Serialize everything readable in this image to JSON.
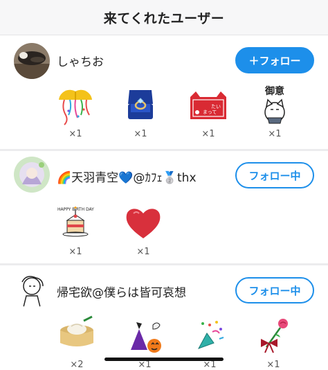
{
  "header": {
    "title": "来てくれたユーザー"
  },
  "users": [
    {
      "name": "しゃちお",
      "follow_label": "＋フォロー",
      "gifts": [
        {
          "icon": "ribbon-balls-icon",
          "count": "×1"
        },
        {
          "icon": "ring-box-icon",
          "count": "×1"
        },
        {
          "icon": "red-cat-card-icon",
          "count": "×1"
        },
        {
          "icon": "goshuin-cat-icon",
          "count": "×1",
          "text": "御意"
        }
      ]
    },
    {
      "name": "🌈天羽青空💙@ｶﾌｪ🥈thx",
      "follow_label": "フォロー中",
      "gifts": [
        {
          "icon": "birthday-cake-icon",
          "count": "×1",
          "text": "HAPPY BIRTH DAY"
        },
        {
          "icon": "heart-icon",
          "count": "×1"
        }
      ]
    },
    {
      "name": "帰宅欲@僕らは皆可哀想",
      "follow_label": "フォロー中",
      "gifts": [
        {
          "icon": "steamer-bun-icon",
          "count": "×2"
        },
        {
          "icon": "halloween-icon",
          "count": "×1"
        },
        {
          "icon": "party-popper-icon",
          "count": "×1"
        },
        {
          "icon": "rose-ribbon-icon",
          "count": "×1"
        }
      ]
    }
  ],
  "colors": {
    "accent": "#1d8fea",
    "divider": "#ececee"
  }
}
